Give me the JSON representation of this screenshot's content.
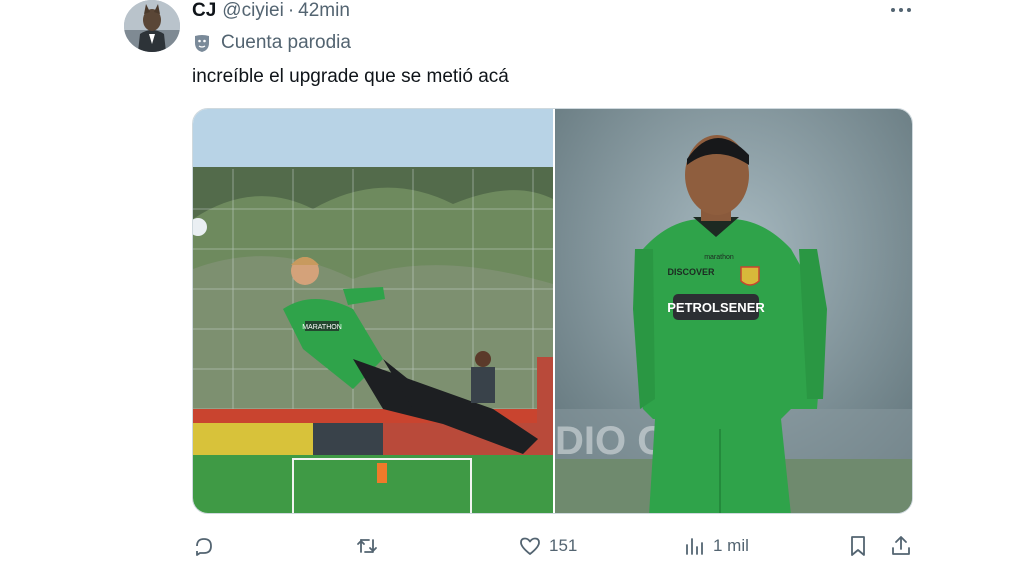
{
  "tweet": {
    "author_name": "CJ",
    "handle": "@ciyiei",
    "separator": "·",
    "time": "42min",
    "parody_label": "Cuenta parodia",
    "text": "increíble el upgrade que se metió acá"
  },
  "media": {
    "left_jersey_text": "MARATHON",
    "right_jersey_sponsor": "PETROLSENER",
    "right_jersey_partner": "DISCOVER",
    "right_jersey_maker": "marathon",
    "right_background_text": "DIO    CO P"
  },
  "actions": {
    "reply_count": "",
    "retweet_count": "",
    "like_count": "151",
    "views_count": "1 mil"
  },
  "icons": {
    "reply": "reply-icon",
    "retweet": "retweet-icon",
    "like": "heart-icon",
    "views": "views-icon",
    "bookmark": "bookmark-icon",
    "share": "share-icon",
    "more": "more-icon",
    "parody": "theater-mask-icon"
  },
  "colors": {
    "text_primary": "#0f1419",
    "text_secondary": "#536471",
    "jersey_green": "#2fa34a",
    "pitch_green": "#3a8f3e"
  }
}
